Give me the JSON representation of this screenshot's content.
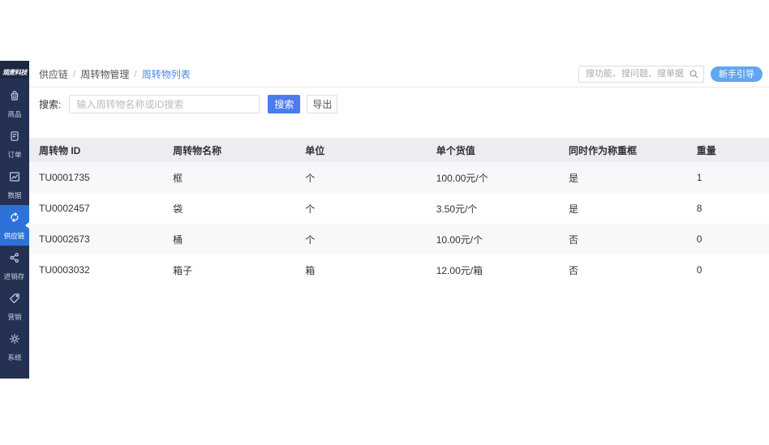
{
  "logo": "观麦科技",
  "sidebar": {
    "items": [
      {
        "label": "商品",
        "icon": "goods-bag-icon",
        "active": false
      },
      {
        "label": "订单",
        "icon": "order-doc-icon",
        "active": false
      },
      {
        "label": "数据",
        "icon": "data-chart-icon",
        "active": false
      },
      {
        "label": "供应链",
        "icon": "supply-chain-cycle-icon",
        "active": true
      },
      {
        "label": "进销存",
        "icon": "inventory-nodes-icon",
        "active": false
      },
      {
        "label": "营销",
        "icon": "marketing-tag-icon",
        "active": false
      },
      {
        "label": "系统",
        "icon": "system-gear-icon",
        "active": false
      }
    ]
  },
  "header": {
    "breadcrumb": {
      "0": "供应链",
      "1": "周转物管理",
      "2": "周转物列表"
    },
    "separator": "/",
    "search_placeholder": "搜功能、搜问题、搜单据",
    "guide_button": "新手引导"
  },
  "filter": {
    "label": "搜索:",
    "input_placeholder": "输入周转物名称或ID搜索",
    "search_button": "搜索",
    "export_button": "导出"
  },
  "table": {
    "headers": [
      "周转物 ID",
      "周转物名称",
      "单位",
      "单个货值",
      "同时作为称重框",
      "重量"
    ],
    "rows": [
      [
        "TU0001735",
        "框",
        "个",
        "100.00元/个",
        "是",
        "1"
      ],
      [
        "TU0002457",
        "袋",
        "个",
        "3.50元/个",
        "是",
        "8"
      ],
      [
        "TU0002673",
        "桶",
        "个",
        "10.00元/个",
        "否",
        "0"
      ],
      [
        "TU0003032",
        "箱子",
        "箱",
        "12.00元/箱",
        "否",
        "0"
      ]
    ]
  },
  "colors": {
    "sidebar_bg": "#253153",
    "logo_bg": "#1d2844",
    "active_item_bg": "#2e72d8",
    "breadcrumb_current": "#4a87e8",
    "search_button_bg": "#4a7bf1",
    "guide_button_bg": "#61a6f0",
    "table_header_bg": "#ecedf1",
    "row_alt_bg": "#f7f8fa"
  }
}
